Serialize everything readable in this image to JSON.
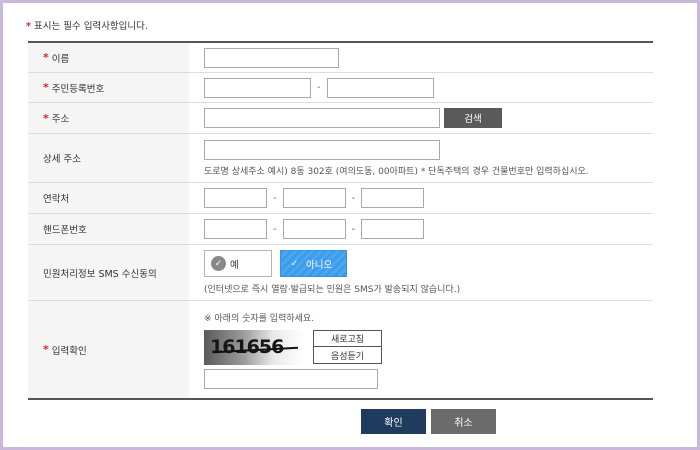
{
  "notice": {
    "star": "*",
    "text": "표시는 필수 입력사항입니다."
  },
  "fields": {
    "name": {
      "star": "*",
      "label": "이름",
      "value": ""
    },
    "rrn": {
      "star": "*",
      "label": "주민등록번호",
      "part1": "",
      "part2": "",
      "separator": "-"
    },
    "address": {
      "star": "*",
      "label": "주소",
      "value": "",
      "search_label": "검색"
    },
    "address_detail": {
      "label": "상세 주소",
      "value": "",
      "hint": "도로명 상세주소 예시) 8동 302호 (여의도동, 00아파트) * 단독주택의 경우 건물번호만 입력하십시오."
    },
    "contact": {
      "label": "연락처",
      "p1": "",
      "p2": "",
      "p3": "",
      "separator": "-"
    },
    "mobile": {
      "label": "핸드폰번호",
      "p1": "",
      "p2": "",
      "p3": "",
      "separator": "-"
    },
    "sms": {
      "label": "민원처리정보 SMS 수신동의",
      "yes_label": "예",
      "no_label": "아니오",
      "selected": "no",
      "hint": "(인터넷으로 즉시 열람·발급되는 민원은 SMS가 발송되지 않습니다.)"
    },
    "captcha": {
      "star": "*",
      "label": "입력확인",
      "instruction": "※ 아래의 숫자를 입력하세요.",
      "image_text": "161656",
      "refresh_label": "새로고침",
      "audio_label": "음성듣기",
      "value": ""
    }
  },
  "buttons": {
    "confirm": "확인",
    "cancel": "취소"
  },
  "colors": {
    "required": "#d6262d",
    "confirm": "#1f3c5e",
    "cancel": "#6b6b6b",
    "search": "#5a5a5a",
    "toggle_selected": "#3d9be9"
  }
}
